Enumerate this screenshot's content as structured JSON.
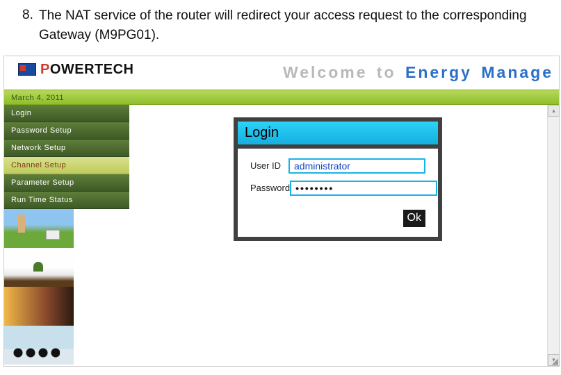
{
  "doc": {
    "item_number": "8.",
    "text": "The NAT service of the router will redirect your access request to the corresponding Gateway (M9PG01)."
  },
  "brand": {
    "name_red": "P",
    "name_rest": "OWERTECH"
  },
  "header": {
    "welcome_prefix": "Welcome to ",
    "welcome_suffix": "Energy Manage"
  },
  "date_bar": "March 4, 2011",
  "sidebar": {
    "items": [
      {
        "label": "Login",
        "active": false
      },
      {
        "label": "Password Setup",
        "active": false
      },
      {
        "label": "Network Setup",
        "active": false
      },
      {
        "label": "Channel Setup",
        "active": true
      },
      {
        "label": "Parameter Setup",
        "active": false
      },
      {
        "label": "Run Time Status",
        "active": false
      }
    ]
  },
  "login": {
    "title": "Login",
    "user_label": "User ID",
    "user_value": "administrator",
    "password_label": "Password",
    "password_value": "••••••••",
    "ok_label": "Ok"
  }
}
